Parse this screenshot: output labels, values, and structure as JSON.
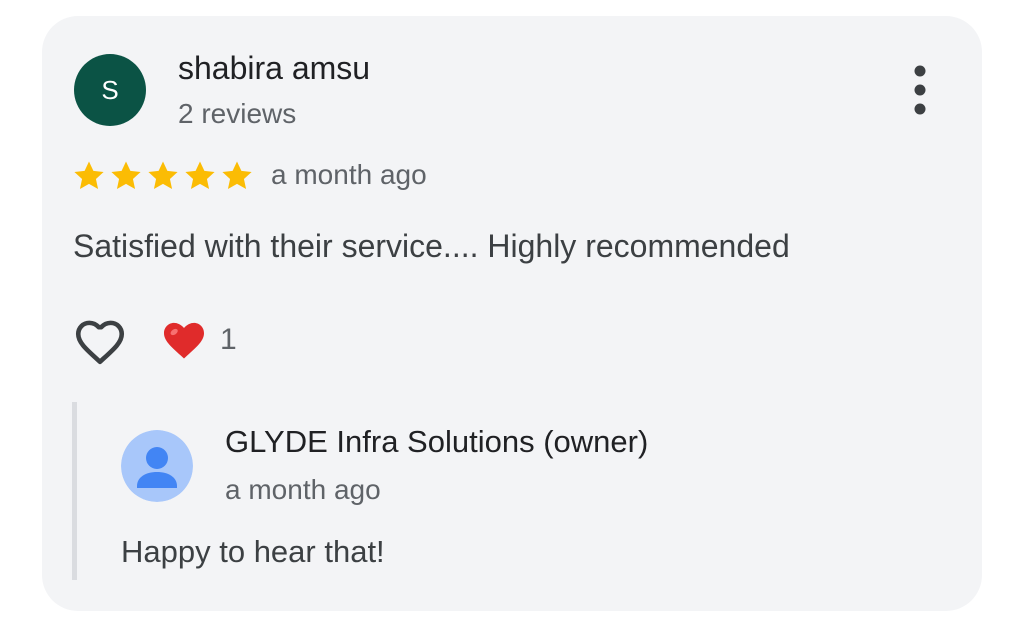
{
  "review": {
    "author": {
      "name": "shabira amsu",
      "initial": "S",
      "reviews_count": "2 reviews",
      "avatar_color": "#0b5345"
    },
    "rating": 5,
    "rating_max": 5,
    "star_color": "#fbbc04",
    "date": "a month ago",
    "text": "Satisfied with their service.... Highly recommended",
    "more_icon": "more-vert-icon",
    "like_icon": "heart-outline-icon",
    "reaction": {
      "icon": "red-heart-emoji",
      "emoji": "❤️",
      "count": "1"
    }
  },
  "owner_response": {
    "name": "GLYDE Infra Solutions (owner)",
    "date": "a month ago",
    "text": "Happy to hear that!",
    "avatar_icon": "default-person-icon",
    "avatar_bg": "#a8c7fa",
    "avatar_fg": "#4285f4"
  },
  "colors": {
    "card_bg": "#f3f4f6",
    "text_primary": "#202124",
    "text_secondary": "#5f6368",
    "reply_border": "#dadce0"
  }
}
